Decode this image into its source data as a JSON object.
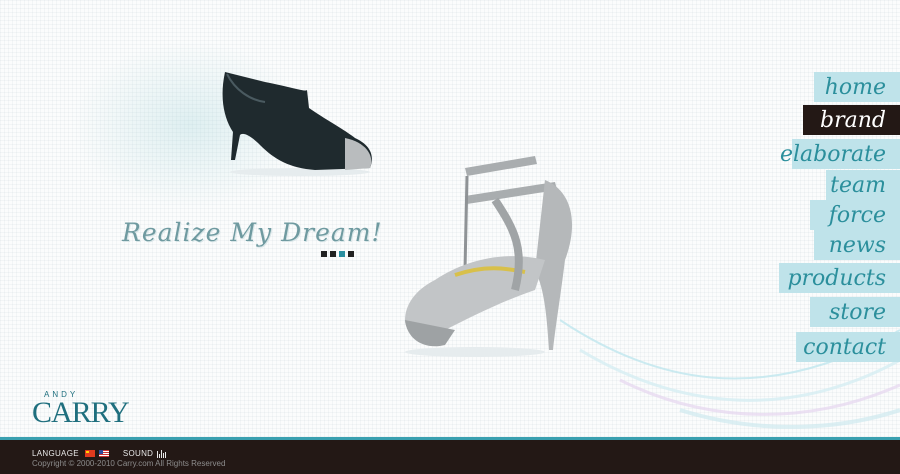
{
  "hero": {
    "slogan": "Realize My Dream!",
    "slides_total": 4,
    "active_slide": 3
  },
  "nav": {
    "items": [
      {
        "label": "home",
        "active": false
      },
      {
        "label": "brand",
        "active": true
      },
      {
        "label": "elaborate",
        "active": false
      },
      {
        "label": "team",
        "active": false
      },
      {
        "label": "force",
        "active": false
      },
      {
        "label": "news",
        "active": false
      },
      {
        "label": "products",
        "active": false
      },
      {
        "label": "store",
        "active": false
      },
      {
        "label": "contact",
        "active": false
      }
    ]
  },
  "logo": {
    "small_text": "ANDY",
    "main_text": "CARRY"
  },
  "footer": {
    "language_label": "LANGUAGE",
    "sound_label": "SOUND",
    "copyright": "Copyright © 2000-2010 Carry.com All Rights Reserved"
  },
  "colors": {
    "accent": "#2b8f9c",
    "nav_bg": "#bfe3ea",
    "nav_active_bg": "#231815",
    "footer_bg": "#231815"
  },
  "icons": [
    "china-flag-icon",
    "usa-flag-icon",
    "sound-bars-icon"
  ]
}
